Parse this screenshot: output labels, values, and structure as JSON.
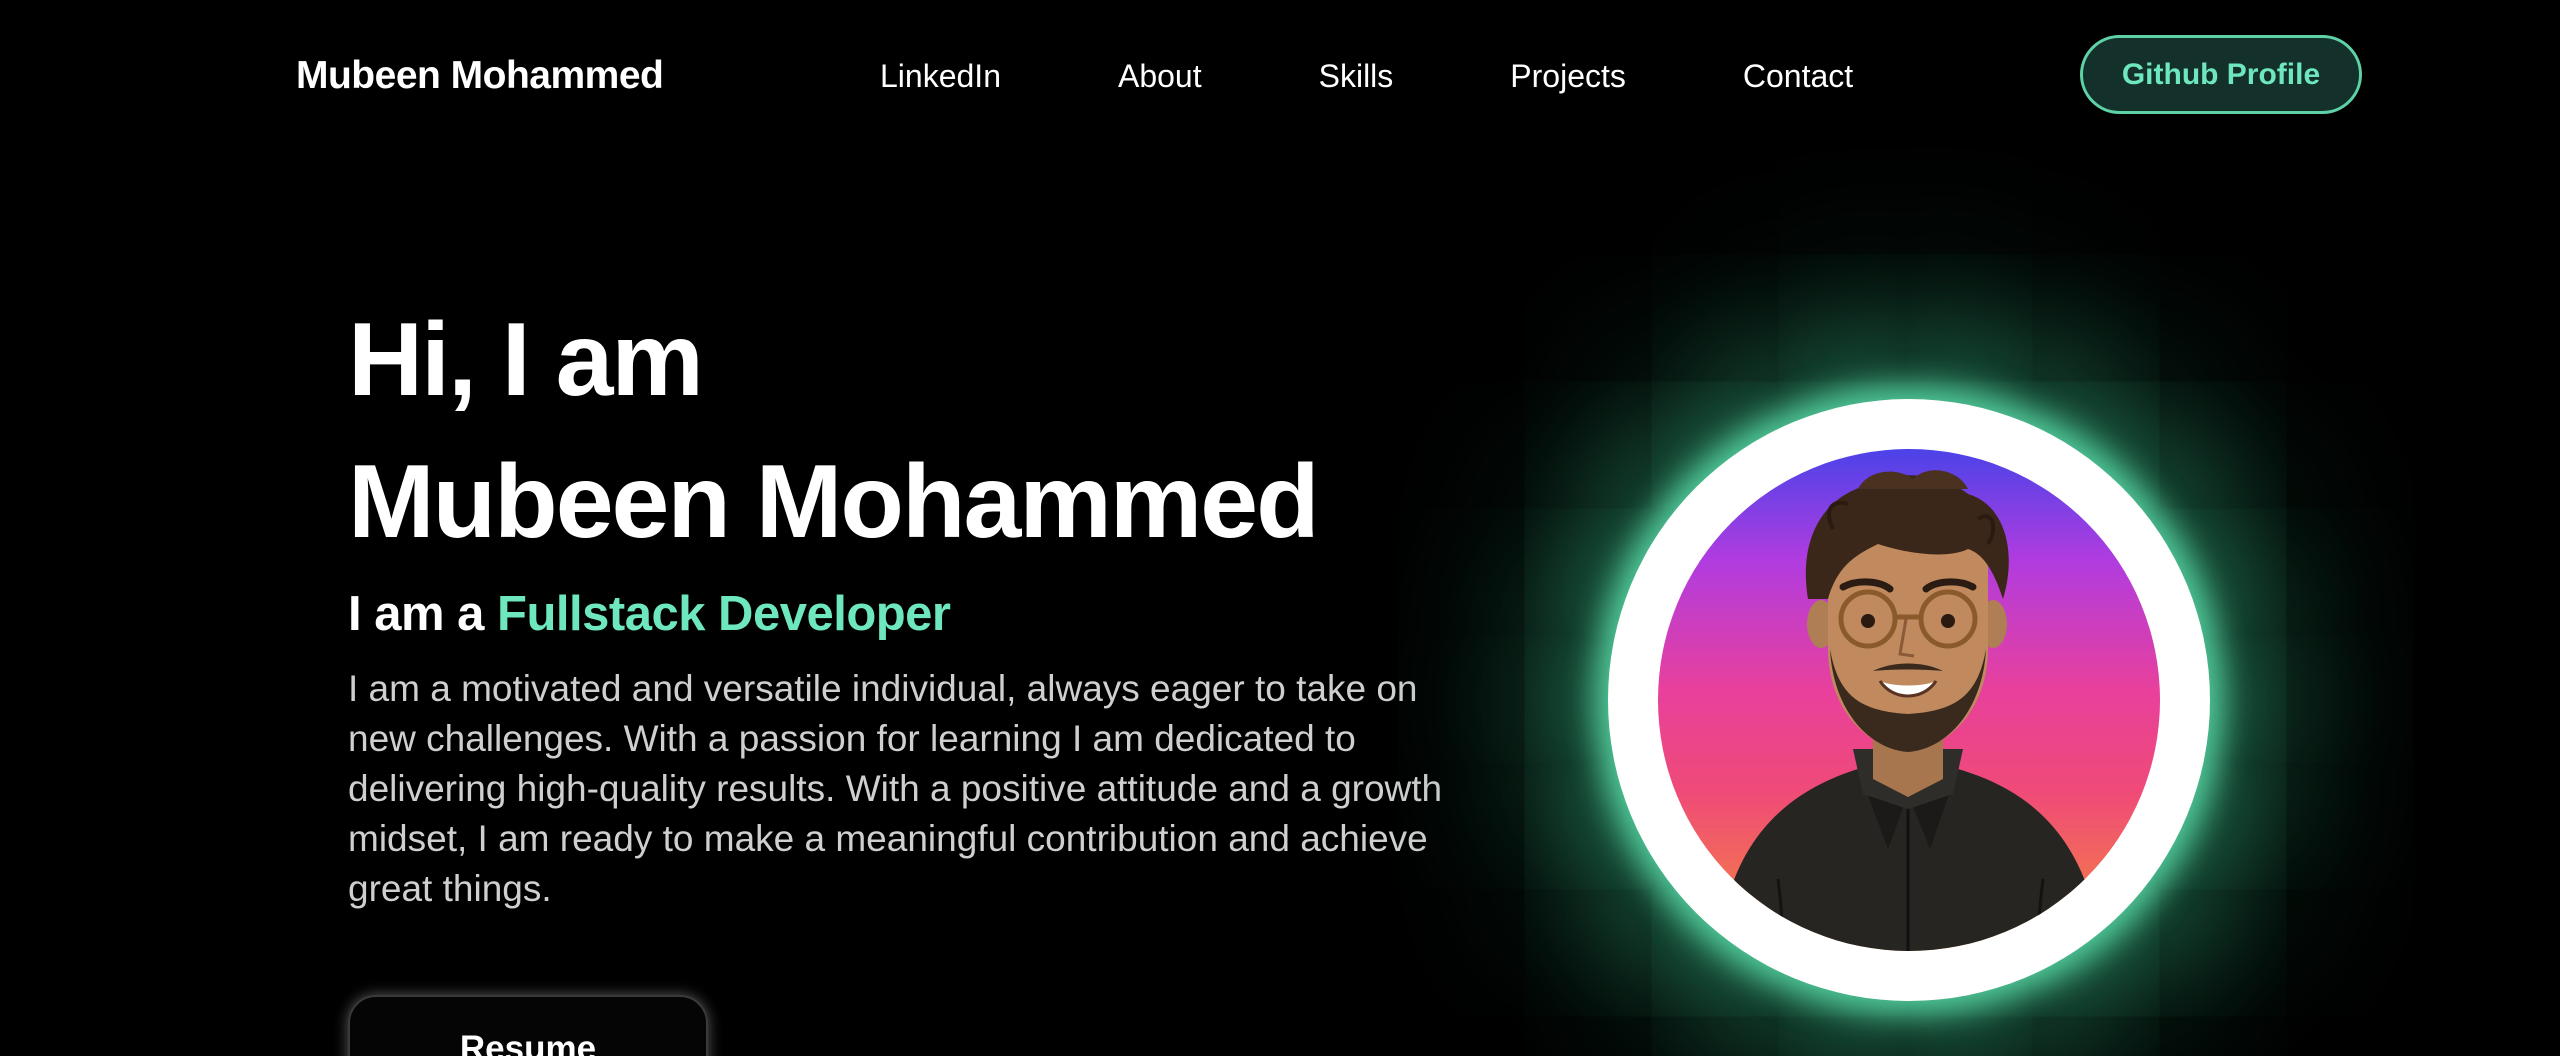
{
  "header": {
    "brand": "Mubeen Mohammed",
    "nav": [
      {
        "label": "LinkedIn"
      },
      {
        "label": "About"
      },
      {
        "label": "Skills"
      },
      {
        "label": "Projects"
      },
      {
        "label": "Contact"
      }
    ],
    "cta_label": "Github Profile"
  },
  "hero": {
    "greeting": "Hi, I am",
    "name": "Mubeen Mohammed",
    "role_prefix": "I am a ",
    "role_highlight": "Fullstack Developer",
    "description": "I am a motivated and versatile individual, always eager to take on new challenges. With a passion for learning I am dedicated to delivering high-quality results. With a positive attitude and a growth midset, I am ready to make a meaningful contribution and achieve great things.",
    "resume_label": "Resume"
  },
  "theme": {
    "background": "#000000",
    "accent": "#6ee7bf",
    "text": "#ffffff",
    "muted_text": "#cfcfcf"
  },
  "icons": {
    "avatar": "developer-portrait-illustration"
  }
}
